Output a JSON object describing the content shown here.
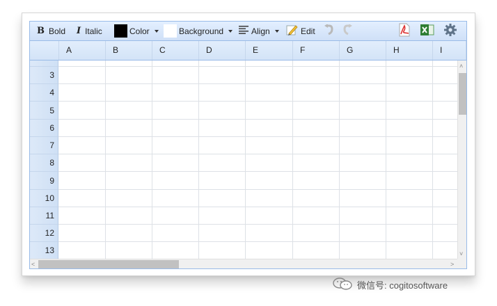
{
  "toolbar": {
    "bold_label": "Bold",
    "italic_label": "Italic",
    "color_label": "Color",
    "background_label": "Background",
    "align_label": "Align",
    "edit_label": "Edit",
    "text_color": "#000000",
    "background_color": "#ffffff",
    "icons": [
      "bold-icon",
      "italic-icon",
      "pencil-icon",
      "undo-icon",
      "redo-icon",
      "pdf-icon",
      "excel-icon",
      "gear-icon"
    ]
  },
  "columns": [
    "A",
    "B",
    "C",
    "D",
    "E",
    "F",
    "G",
    "H",
    "I"
  ],
  "rows": [
    "3",
    "4",
    "5",
    "6",
    "7",
    "8",
    "9",
    "10",
    "11",
    "12",
    "13"
  ],
  "watermark": {
    "text": "微信号: cogitosoftware"
  },
  "colors": {
    "accent": "#99bbe8",
    "header_bg": "#d3e3f7"
  }
}
